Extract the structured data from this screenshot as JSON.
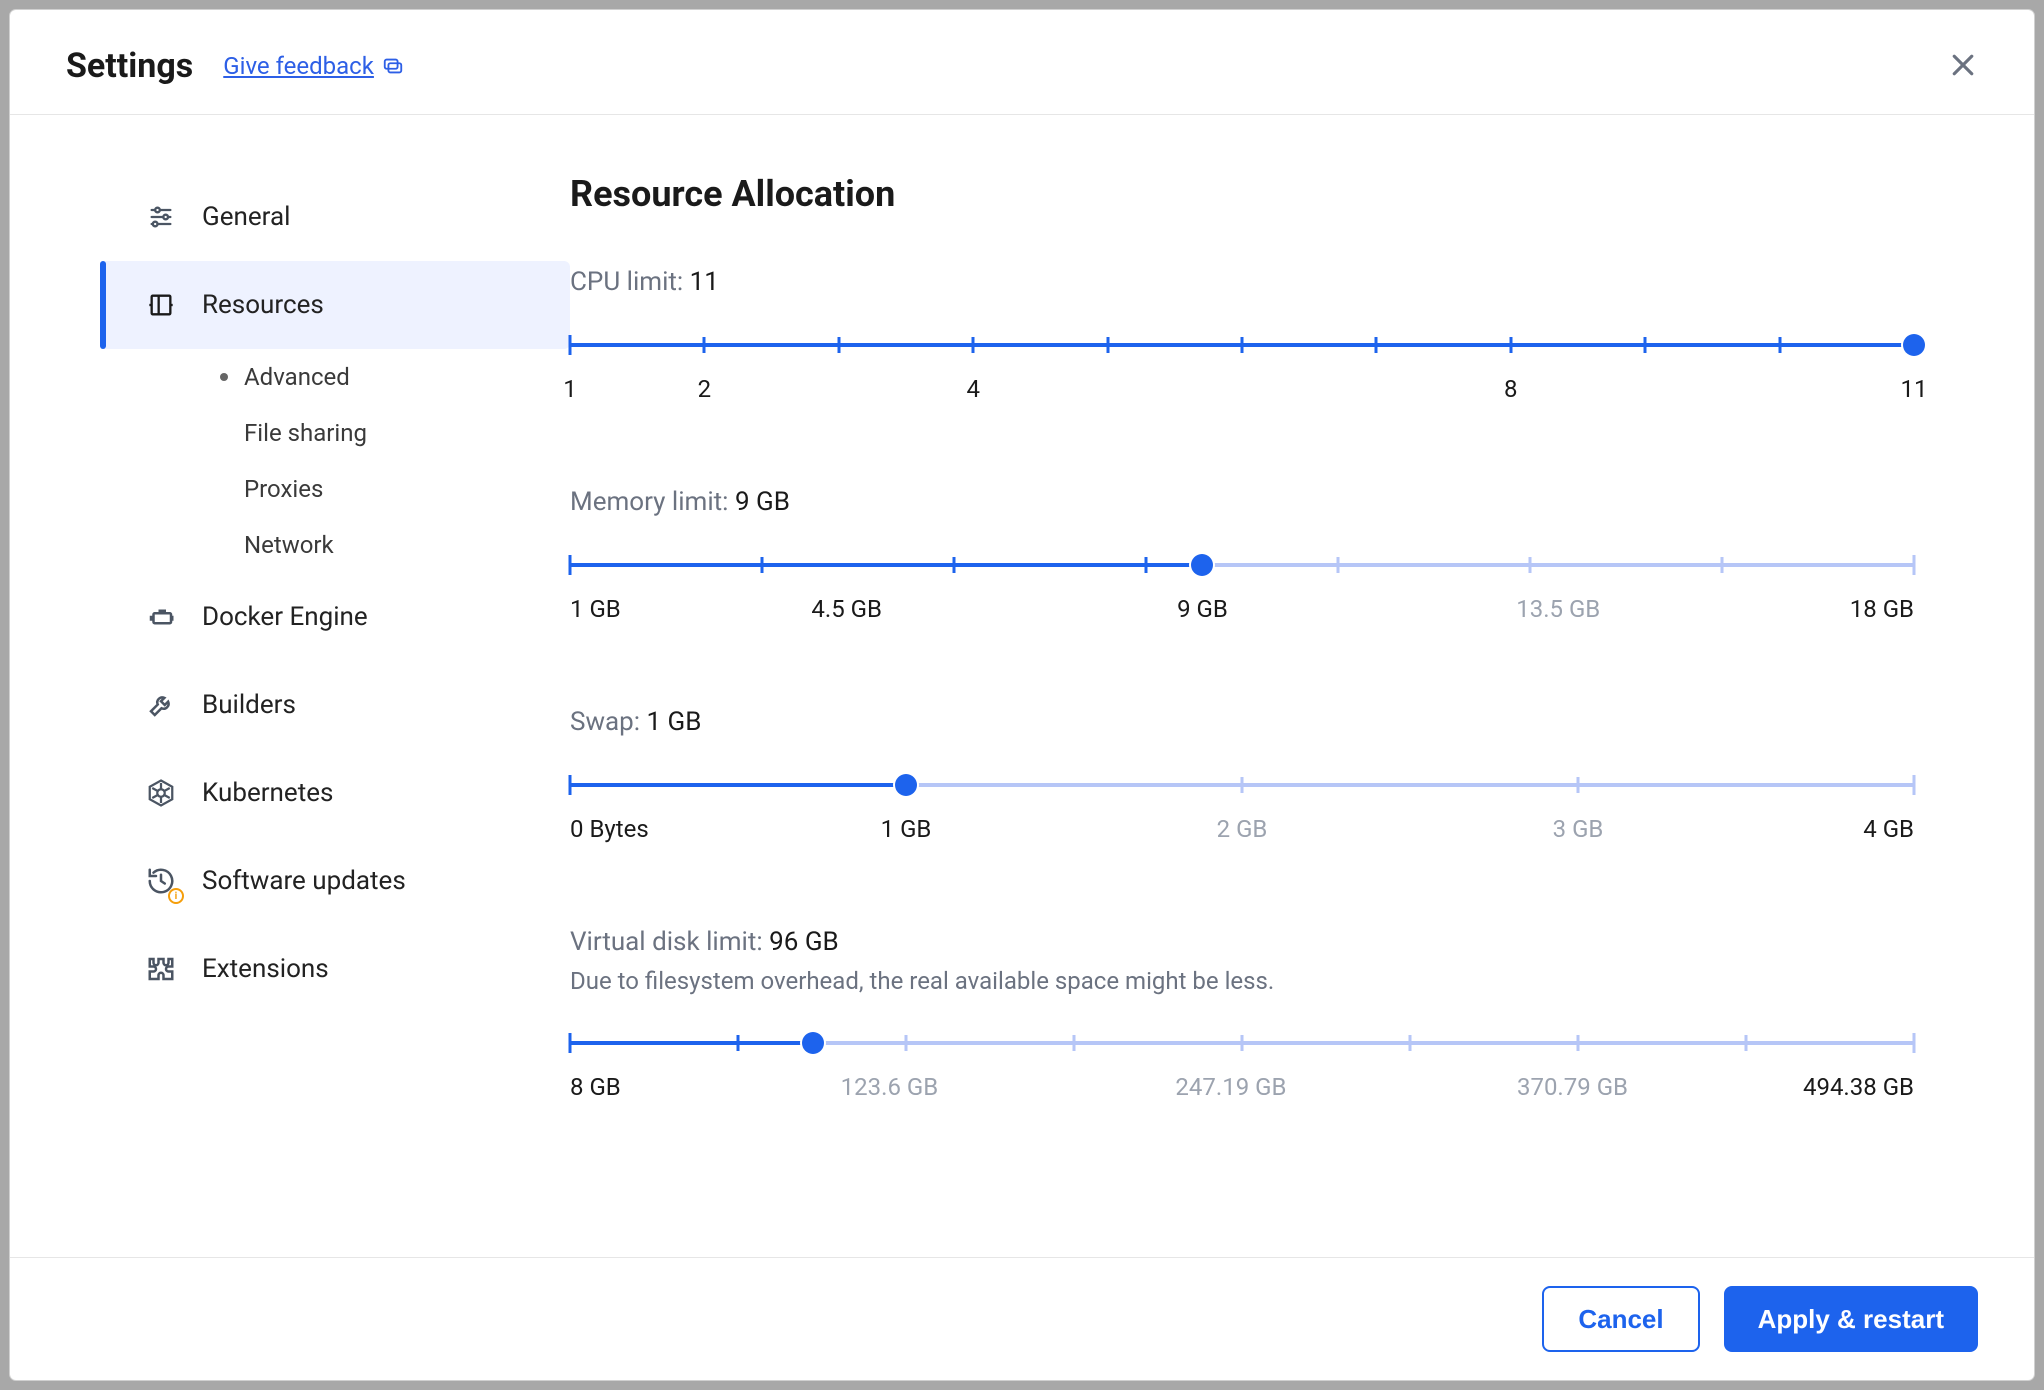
{
  "header": {
    "title": "Settings",
    "feedback_label": "Give feedback"
  },
  "sidebar": {
    "items": [
      {
        "id": "general",
        "label": "General",
        "icon": "sliders-icon",
        "active": false
      },
      {
        "id": "resources",
        "label": "Resources",
        "icon": "columns-icon",
        "active": true,
        "subitems": [
          {
            "id": "advanced",
            "label": "Advanced",
            "selected": true
          },
          {
            "id": "filesharing",
            "label": "File sharing",
            "selected": false
          },
          {
            "id": "proxies",
            "label": "Proxies",
            "selected": false
          },
          {
            "id": "network",
            "label": "Network",
            "selected": false
          }
        ]
      },
      {
        "id": "docker-engine",
        "label": "Docker Engine",
        "icon": "engine-icon",
        "active": false
      },
      {
        "id": "builders",
        "label": "Builders",
        "icon": "wrench-icon",
        "active": false
      },
      {
        "id": "kubernetes",
        "label": "Kubernetes",
        "icon": "helm-icon",
        "active": false
      },
      {
        "id": "software-updates",
        "label": "Software updates",
        "icon": "clock-icon",
        "active": false,
        "info_badge": true
      },
      {
        "id": "extensions",
        "label": "Extensions",
        "icon": "puzzle-icon",
        "active": false
      }
    ]
  },
  "content": {
    "section_title": "Resource Allocation",
    "sliders": {
      "cpu": {
        "label": "CPU limit:",
        "value_label": "11",
        "min": 1,
        "max": 11,
        "value": 11,
        "ticks": [
          1,
          2,
          3,
          4,
          5,
          6,
          7,
          8,
          9,
          10,
          11
        ],
        "axis_labels": [
          {
            "at": 1,
            "text": "1"
          },
          {
            "at": 2,
            "text": "2"
          },
          {
            "at": 4,
            "text": "4"
          },
          {
            "at": 8,
            "text": "8"
          },
          {
            "at": 11,
            "text": "11"
          }
        ]
      },
      "memory": {
        "label": "Memory limit:",
        "value_label": "9 GB",
        "min": 1,
        "max": 18,
        "value": 9,
        "tick_count": 8,
        "axis_labels": [
          {
            "at": 1,
            "text": "1 GB",
            "align": "left"
          },
          {
            "at": 4.5,
            "text": "4.5 GB"
          },
          {
            "at": 9,
            "text": "9 GB"
          },
          {
            "at": 13.5,
            "text": "13.5 GB",
            "muted": true
          },
          {
            "at": 18,
            "text": "18 GB",
            "align": "right"
          }
        ]
      },
      "swap": {
        "label": "Swap:",
        "value_label": "1 GB",
        "min": 0,
        "max": 4,
        "value": 1,
        "tick_count": 5,
        "axis_labels": [
          {
            "at": 0,
            "text": "0 Bytes",
            "align": "left"
          },
          {
            "at": 1,
            "text": "1 GB"
          },
          {
            "at": 2,
            "text": "2 GB",
            "muted": true
          },
          {
            "at": 3,
            "text": "3 GB",
            "muted": true
          },
          {
            "at": 4,
            "text": "4 GB",
            "align": "right"
          }
        ]
      },
      "disk": {
        "label": "Virtual disk limit:",
        "value_label": "96 GB",
        "hint": "Due to filesystem overhead, the real available space might be less.",
        "min": 8,
        "max": 494.38,
        "value": 96,
        "tick_count": 9,
        "axis_labels": [
          {
            "at": 8,
            "text": "8 GB",
            "align": "left"
          },
          {
            "at": 123.6,
            "text": "123.6 GB",
            "muted": true
          },
          {
            "at": 247.19,
            "text": "247.19 GB",
            "muted": true
          },
          {
            "at": 370.79,
            "text": "370.79 GB",
            "muted": true
          },
          {
            "at": 494.38,
            "text": "494.38 GB",
            "align": "right"
          }
        ]
      }
    }
  },
  "footer": {
    "cancel_label": "Cancel",
    "apply_label": "Apply & restart"
  }
}
